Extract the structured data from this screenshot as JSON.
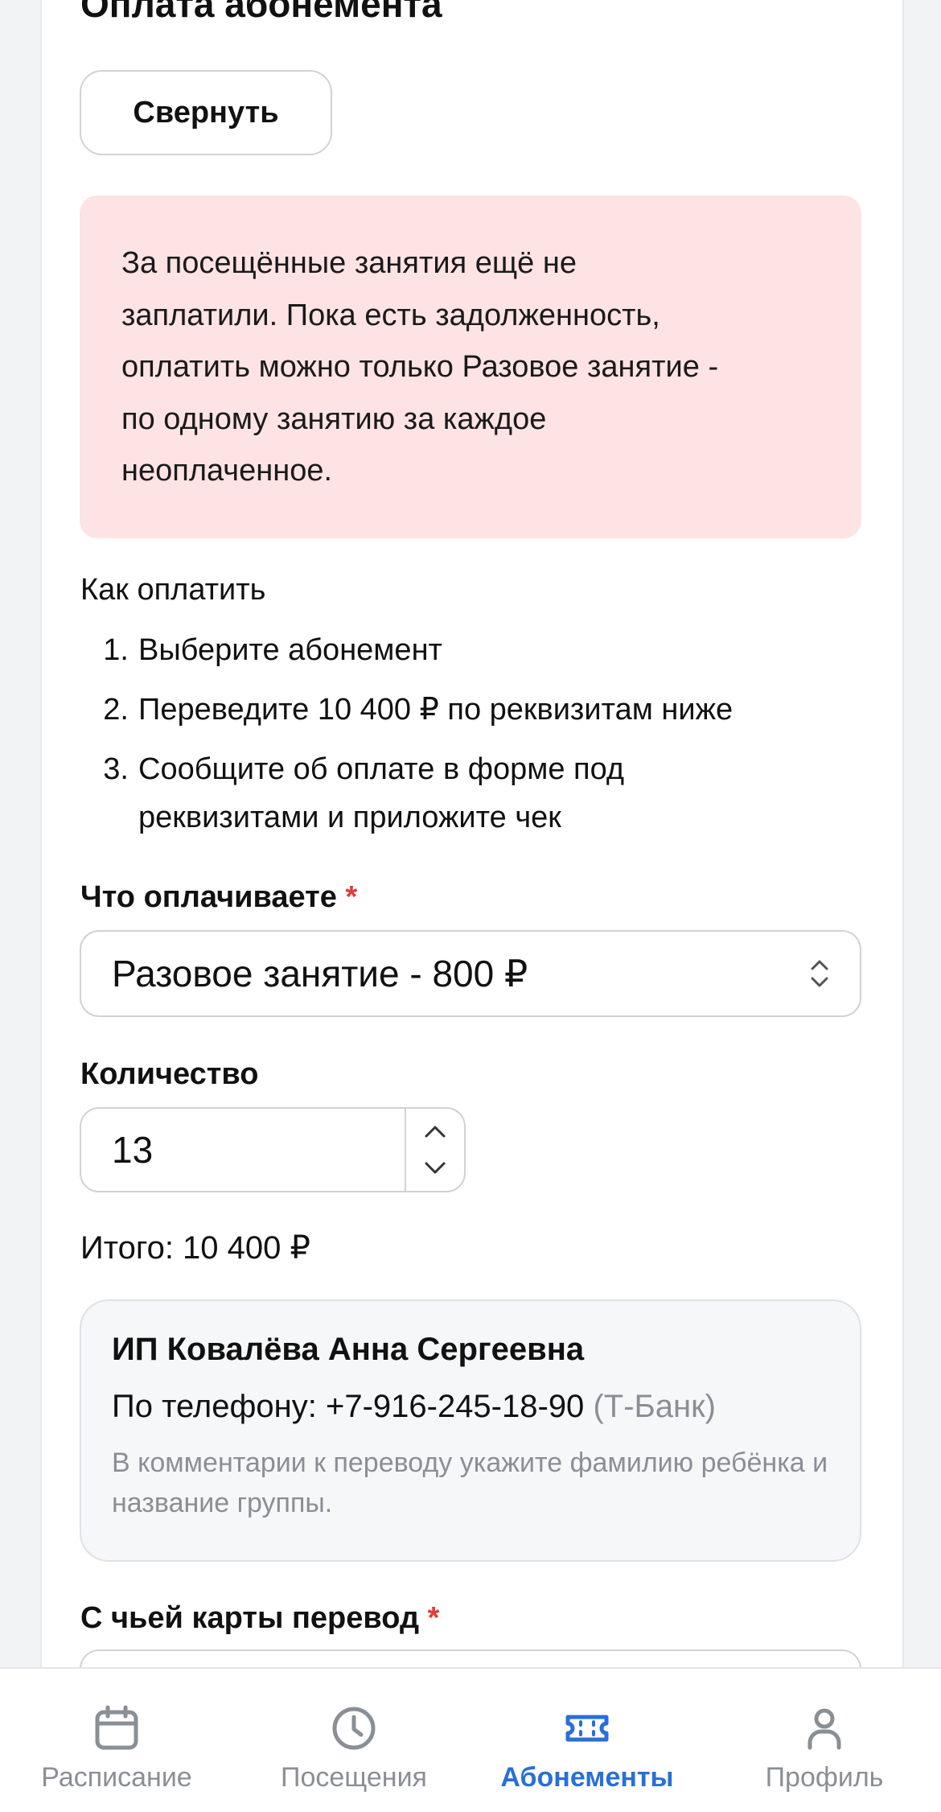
{
  "page": {
    "title": "Оплата абонемента",
    "collapse_label": "Свернуть"
  },
  "alert": {
    "lines": [
      "За посещённые занятия ещё не",
      "заплатили. Пока есть задолженность,",
      "оплатить можно только Разовое занятие -",
      "по одному занятию за каждое",
      "неоплаченное."
    ]
  },
  "how_to": {
    "title": "Как оплатить",
    "steps": [
      {
        "num": "1.",
        "text": "Выберите абонемент"
      },
      {
        "num": "2.",
        "text": "Переведите 10 400 ₽ по реквизитам ниже"
      },
      {
        "num": "3.",
        "text": "Сообщите об оплате в форме под реквизитами и приложите чек"
      }
    ]
  },
  "form": {
    "what_label": "Что оплачиваете",
    "required_mark": "*",
    "what_value": "Разовое занятие - 800 ₽",
    "qty_label": "Количество",
    "qty_value": "13",
    "total": "Итого: 10 400 ₽",
    "card_label": "С чьей карты перевод"
  },
  "requisites": {
    "name": "ИП Ковалёва Анна Сергеевна",
    "phone_prefix": "По телефону: +7-916-245-18-90",
    "bank": "(Т-Банк)",
    "note": "В комментарии к переводу укажите фамилию ребёнка и название группы."
  },
  "tabs": [
    {
      "label": "Расписание",
      "icon": "calendar-icon",
      "active": false
    },
    {
      "label": "Посещения",
      "icon": "clock-icon",
      "active": false
    },
    {
      "label": "Абонементы",
      "icon": "ticket-icon",
      "active": true
    },
    {
      "label": "Профиль",
      "icon": "person-icon",
      "active": false
    }
  ],
  "colors": {
    "accent": "#2a6fd6",
    "alert_bg": "#fde3e3",
    "required": "#e23b3b",
    "muted": "#8a8f96"
  }
}
